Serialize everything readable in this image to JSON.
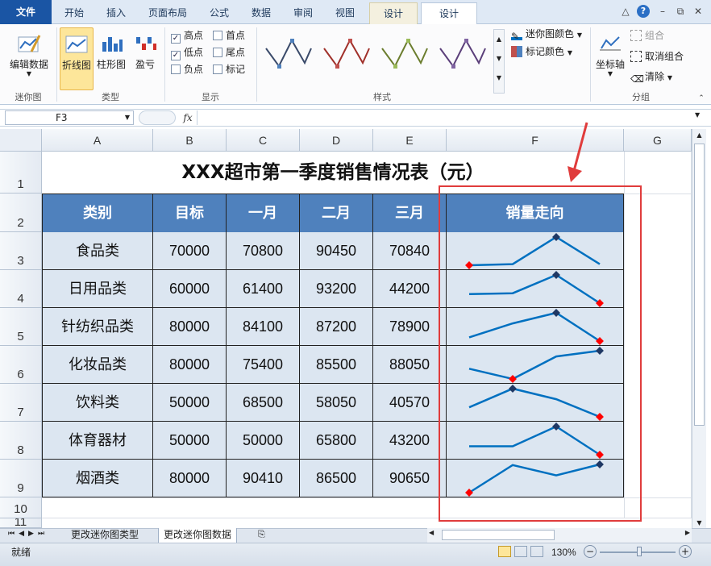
{
  "tabs": [
    {
      "key": "file",
      "label": "文件"
    },
    {
      "key": "home",
      "label": "开始"
    },
    {
      "key": "insert",
      "label": "插入"
    },
    {
      "key": "layout",
      "label": "页面布局"
    },
    {
      "key": "formula",
      "label": "公式"
    },
    {
      "key": "data",
      "label": "数据"
    },
    {
      "key": "review",
      "label": "审阅"
    },
    {
      "key": "view",
      "label": "视图"
    },
    {
      "key": "design1",
      "label": "设计"
    },
    {
      "key": "design2",
      "label": "设计"
    }
  ],
  "ribbon": {
    "edit_data": "编辑数据",
    "group_sparkline": "迷你图",
    "type_line": "折线图",
    "type_column": "柱形图",
    "type_winloss": "盈亏",
    "group_type": "类型",
    "show": {
      "high": "高点",
      "first": "首点",
      "low": "低点",
      "last": "尾点",
      "negative": "负点",
      "markers": "标记",
      "high_checked": true,
      "low_checked": true
    },
    "group_show": "显示",
    "group_style": "样式",
    "sparkline_color": "迷你图颜色",
    "marker_color": "标记颜色",
    "axis": "坐标轴",
    "group_btn": "组合",
    "ungroup": "取消组合",
    "clear": "清除",
    "group_group": "分组"
  },
  "formula": {
    "namebox": "F3",
    "fx": "fx",
    "value": ""
  },
  "columns": [
    "A",
    "B",
    "C",
    "D",
    "E",
    "F",
    "G"
  ],
  "rows": [
    "1",
    "2",
    "3",
    "4",
    "5",
    "6",
    "7",
    "8",
    "9",
    "10",
    "11"
  ],
  "sheet": {
    "title": "XXX超市第一季度销售情况表（元）",
    "headers": [
      "类别",
      "目标",
      "一月",
      "二月",
      "三月",
      "销量走向"
    ],
    "data": [
      [
        "食品类",
        "70000",
        "70800",
        "90450",
        "70840"
      ],
      [
        "日用品类",
        "60000",
        "61400",
        "93200",
        "44200"
      ],
      [
        "针纺织品类",
        "80000",
        "84100",
        "87200",
        "78900"
      ],
      [
        "化妆品类",
        "80000",
        "75400",
        "85500",
        "88050"
      ],
      [
        "饮料类",
        "50000",
        "68500",
        "58050",
        "40570"
      ],
      [
        "体育器材",
        "50000",
        "50000",
        "65800",
        "43200"
      ],
      [
        "烟酒类",
        "80000",
        "90410",
        "86500",
        "90650"
      ]
    ]
  },
  "sparklines": [
    [
      70000,
      70800,
      90450,
      70840
    ],
    [
      60000,
      61400,
      93200,
      44200
    ],
    [
      80000,
      84100,
      87200,
      78900
    ],
    [
      80000,
      75400,
      85500,
      88050
    ],
    [
      50000,
      68500,
      58050,
      40570
    ],
    [
      50000,
      50000,
      65800,
      43200
    ],
    [
      80000,
      90410,
      86500,
      90650
    ]
  ],
  "colors": {
    "line": "#0070c0",
    "high": "#1f3864",
    "low": "#ff0000",
    "header_fill": "#4f81bd",
    "row_fill": "#dce6f1"
  },
  "sheet_tabs": [
    "更改迷你图类型",
    "更改迷你图数据"
  ],
  "status": {
    "ready": "就绪",
    "zoom": "130%"
  }
}
